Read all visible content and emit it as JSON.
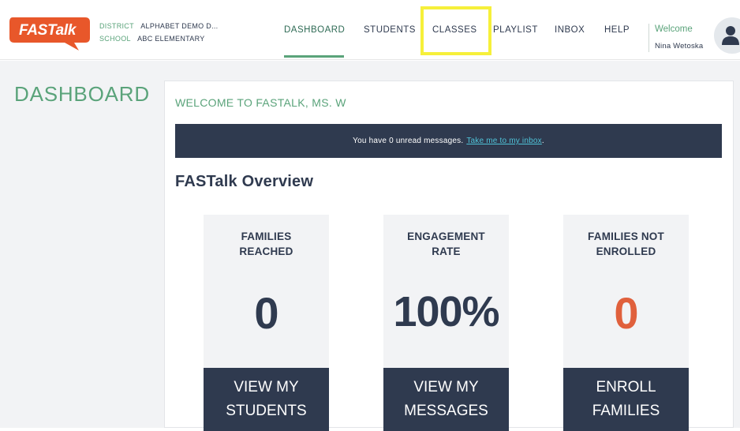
{
  "header": {
    "logo_text": "FASTalk",
    "district_key": "DISTRICT",
    "district_value": "ALPHABET DEMO D...",
    "school_key": "SCHOOL",
    "school_value": "ABC ELEMENTARY",
    "nav": {
      "dashboard": "DASHBOARD",
      "students": "STUDENTS",
      "classes": "CLASSES",
      "playlist": "PLAYLIST",
      "inbox": "INBOX",
      "help": "HELP"
    },
    "welcome_label": "Welcome",
    "welcome_name": "Nina Wetoska"
  },
  "page_title": "DASHBOARD",
  "main": {
    "welcome_heading": "WELCOME TO FASTALK, MS. W",
    "banner_text": "You have 0 unread messages.",
    "banner_link": "Take me to my inbox",
    "banner_period": ".",
    "overview_heading": "FASTalk Overview",
    "cards": [
      {
        "title_line1": "FAMILIES",
        "title_line2": "REACHED",
        "value": "0",
        "button_line1": "VIEW MY",
        "button_line2": "STUDENTS"
      },
      {
        "title_line1": "ENGAGEMENT",
        "title_line2": "RATE",
        "value": "100%",
        "button_line1": "VIEW MY",
        "button_line2": "MESSAGES"
      },
      {
        "title_line1": "FAMILIES NOT",
        "title_line2": "ENROLLED",
        "value": "0",
        "button_line1": "ENROLL",
        "button_line2": "FAMILIES"
      }
    ]
  },
  "colors": {
    "accent_green": "#5aa37a",
    "navy": "#2f3a4f",
    "logo_orange": "#e8572a",
    "warn_orange": "#e0603c",
    "highlight_yellow": "#f6f03a",
    "link_cyan": "#4fc3d8"
  },
  "icons": {
    "logo": "speech-bubble-logo",
    "avatar": "user-icon"
  }
}
